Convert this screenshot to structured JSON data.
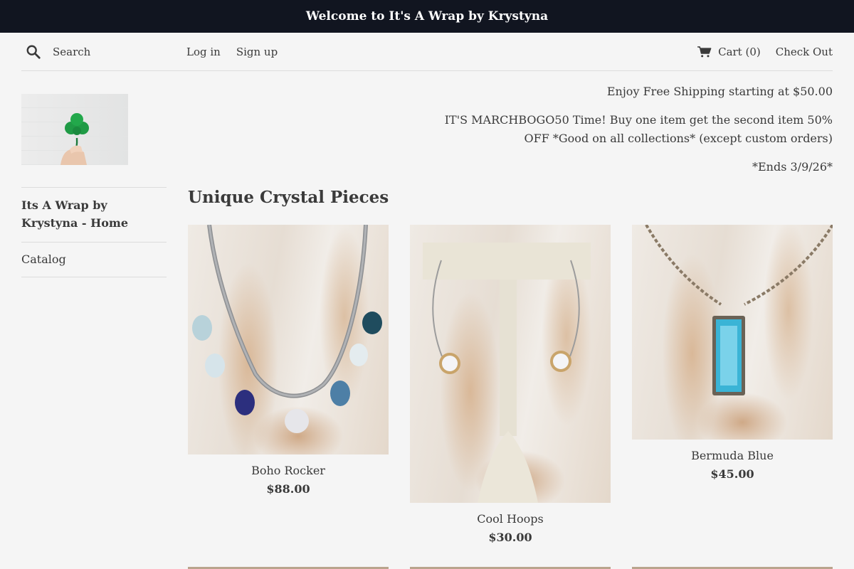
{
  "announcement": "Welcome to It's A Wrap by Krystyna",
  "header": {
    "search_placeholder": "Search",
    "login": "Log in",
    "signup": "Sign up",
    "cart": "Cart (0)",
    "checkout": "Check Out"
  },
  "sidebar": {
    "logo_alt": "shamrock logo",
    "items": [
      {
        "label": "Its A Wrap by Krystyna - Home"
      },
      {
        "label": "Catalog"
      }
    ]
  },
  "promo": {
    "line1": "Enjoy Free Shipping starting at $50.00",
    "line2": "IT'S MARCHBOGO50 Time! Buy one item get the second item 50% OFF *Good on all collections* (except custom orders)",
    "line3": "*Ends 3/9/26*"
  },
  "collection_title": "Unique Crystal Pieces",
  "products": [
    {
      "name": "Boho Rocker",
      "price": "$88.00"
    },
    {
      "name": "Cool Hoops",
      "price": "$30.00"
    },
    {
      "name": "Bermuda Blue",
      "price": "$45.00"
    }
  ],
  "colors": {
    "announcement_bg": "#111520",
    "page_bg": "#f5f5f5",
    "text": "#3a3a3a"
  }
}
